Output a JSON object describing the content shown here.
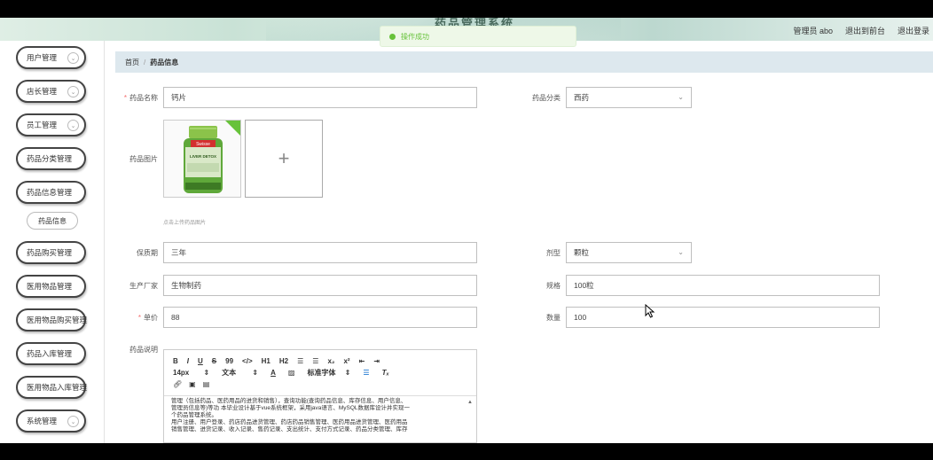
{
  "header": {
    "app_title": "药品管理系统",
    "toast": "操作成功",
    "user_label": "管理员 abo",
    "back_to_front": "退出到前台",
    "logout": "退出登录"
  },
  "sidebar": {
    "items": [
      {
        "label": "用户管理",
        "has_chevron": true
      },
      {
        "label": "店长管理",
        "has_chevron": true
      },
      {
        "label": "员工管理",
        "has_chevron": true
      },
      {
        "label": "药品分类管理",
        "has_chevron": false
      },
      {
        "label": "药品信息管理",
        "has_chevron": false
      },
      {
        "label": "药品信息",
        "submenu": true
      },
      {
        "label": "药品购买管理",
        "has_chevron": false
      },
      {
        "label": "医用物品管理",
        "has_chevron": false
      },
      {
        "label": "医用物品购买管理",
        "has_chevron": false
      },
      {
        "label": "药品入库管理",
        "has_chevron": false
      },
      {
        "label": "医用物品入库管理",
        "has_chevron": false
      },
      {
        "label": "系统管理",
        "has_chevron": true
      }
    ]
  },
  "breadcrumb": {
    "home": "首页",
    "separator": "/",
    "current": "药品信息"
  },
  "form": {
    "name_label": "药品名称",
    "name_value": "钙片",
    "category_label": "药品分类",
    "category_value": "西药",
    "image_label": "药品图片",
    "upload_plus": "+",
    "upload_hint": "点击上传药品图片",
    "shelf_life_label": "保质期",
    "shelf_life_value": "三年",
    "dosage_form_label": "剂型",
    "dosage_form_value": "颗粒",
    "manufacturer_label": "生产厂家",
    "manufacturer_value": "生物制药",
    "spec_label": "规格",
    "spec_value": "100粒",
    "price_label": "单价",
    "price_value": "88",
    "quantity_label": "数量",
    "quantity_value": "100",
    "description_label": "药品说明"
  },
  "thumbnail": {
    "brand": "Swisse",
    "product": "LIVER DETOX"
  },
  "editor": {
    "toolbar_row1": [
      "B",
      "I",
      "U",
      "S",
      "99",
      "</>",
      "H1",
      "H2",
      "☰",
      "☰",
      "x₂",
      "x²",
      "⇤",
      "⇥"
    ],
    "font_size": "14px",
    "text_style": "文本",
    "font_family": "标准字体",
    "content_lines": [
      "管理（包括药品、医药用品的进货和销售），查询功能(查询药品信息、库存信息、用户信息、",
      "管理员信息等)等功  本毕业设计基于vue系统框架，采用java语言、MySQL数据库设计并实现一",
      "个药品管理系统。",
      "用户注册、用户登录、药店药品进货管理、药店药品销售管理、医药用品进货管理、医药用品",
      "销售管理、进货记录、收入记录、售药记录、支出统计、支付方式记录、药品分类管理、库存"
    ]
  },
  "colors": {
    "accent_green": "#67c23a",
    "breadcrumb_bg": "#dde8ee",
    "required_red": "#f56c6c"
  }
}
